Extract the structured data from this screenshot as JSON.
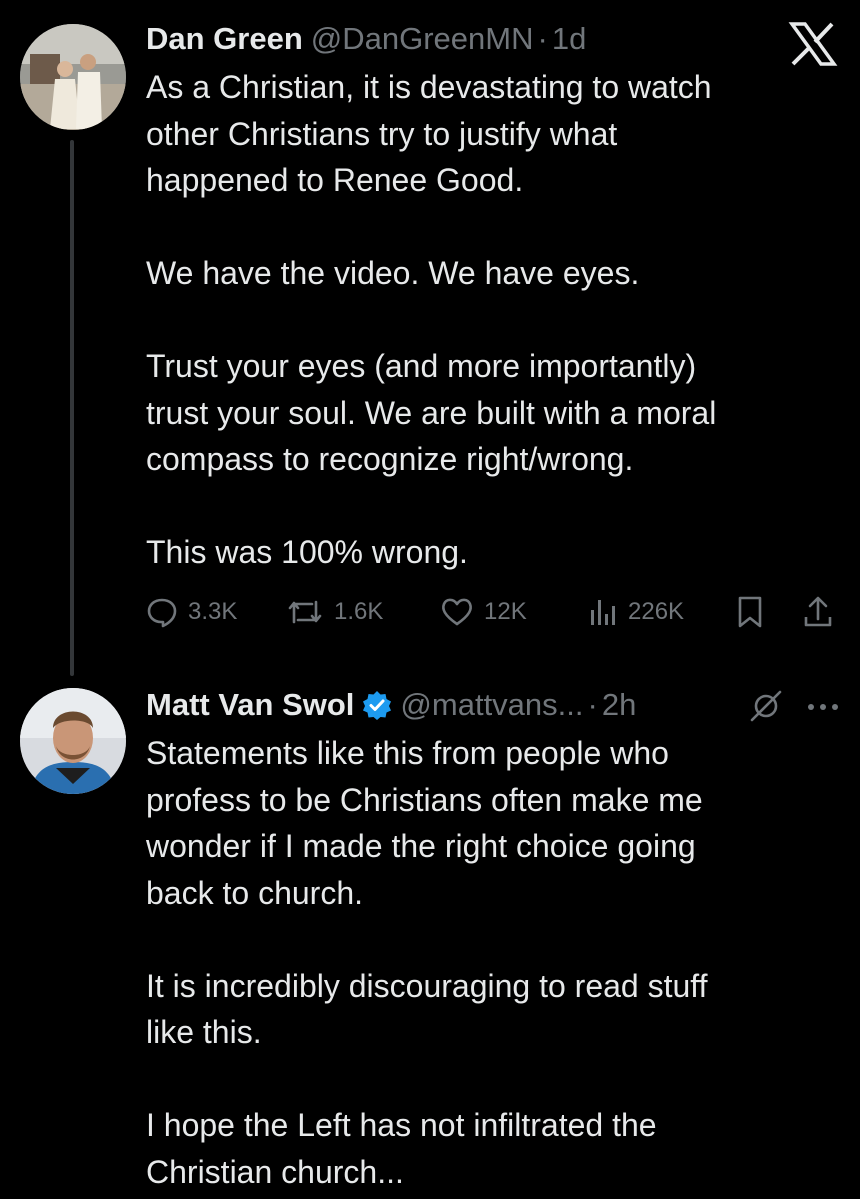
{
  "tweet1": {
    "name": "Dan Green",
    "handle": "@DanGreenMN",
    "separator": "·",
    "time": "1d",
    "text": "As a Christian, it is devastating to watch\nother Christians try to justify what\nhappened to Renee Good.\n\nWe have the video. We have eyes.\n\nTrust your eyes (and more importantly)\ntrust your soul. We are built with a moral\ncompass to recognize right/wrong.\n\nThis was 100% wrong.",
    "stats": {
      "replies": "3.3K",
      "reposts": "1.6K",
      "likes": "12K",
      "views": "226K"
    },
    "icons": [
      "x-logo-icon",
      "reply-icon",
      "repost-icon",
      "like-icon",
      "views-icon",
      "bookmark-icon",
      "share-icon"
    ]
  },
  "tweet2": {
    "name": "Matt Van Swol",
    "handle": "@mattvans...",
    "separator": "·",
    "time": "2h",
    "text": "Statements like this from people who\nprofess to be Christians often make me\nwonder if I made the right choice going\nback to church.\n\nIt is incredibly discouraging to read stuff\nlike this.\n\nI hope the Left has not infiltrated the\nChristian church...",
    "icons": [
      "verified-badge-icon",
      "mute-icon",
      "more-icon"
    ]
  },
  "colors": {
    "background": "#000000",
    "text": "#e7e9ea",
    "secondary": "#71767b",
    "verified": "#1d9bf0"
  }
}
